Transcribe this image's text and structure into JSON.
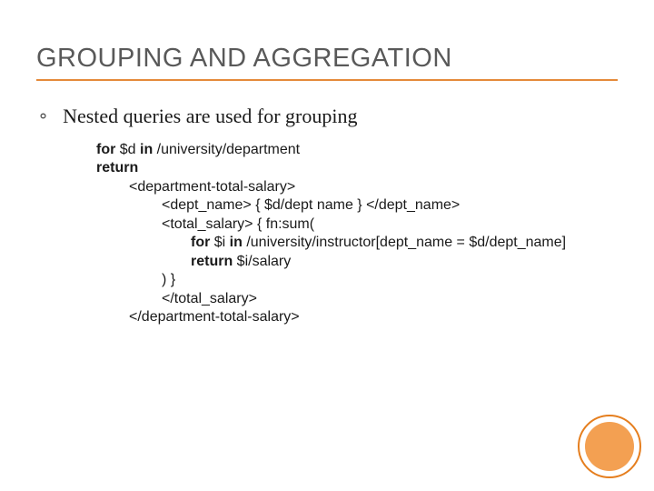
{
  "title": "GROUPING AND AGGREGATION",
  "bullet": "Nested queries are used for grouping",
  "code": {
    "l1a": "for",
    "l1b": " $d ",
    "l1c": "in",
    "l1d": " /university/department",
    "l2": "return",
    "l3": "<department-total-salary>",
    "l4": "<dept_name> { $d/dept name } </dept_name>",
    "l5": "<total_salary> { fn:sum(",
    "l6a": "for",
    "l6b": " $i ",
    "l6c": "in",
    "l6d": " /university/instructor[dept_name = $d/dept_name]",
    "l7a": "return",
    "l7b": " $i/salary",
    "l8": ") }",
    "l9": "</total_salary>",
    "l10": "</department-total-salary>"
  }
}
